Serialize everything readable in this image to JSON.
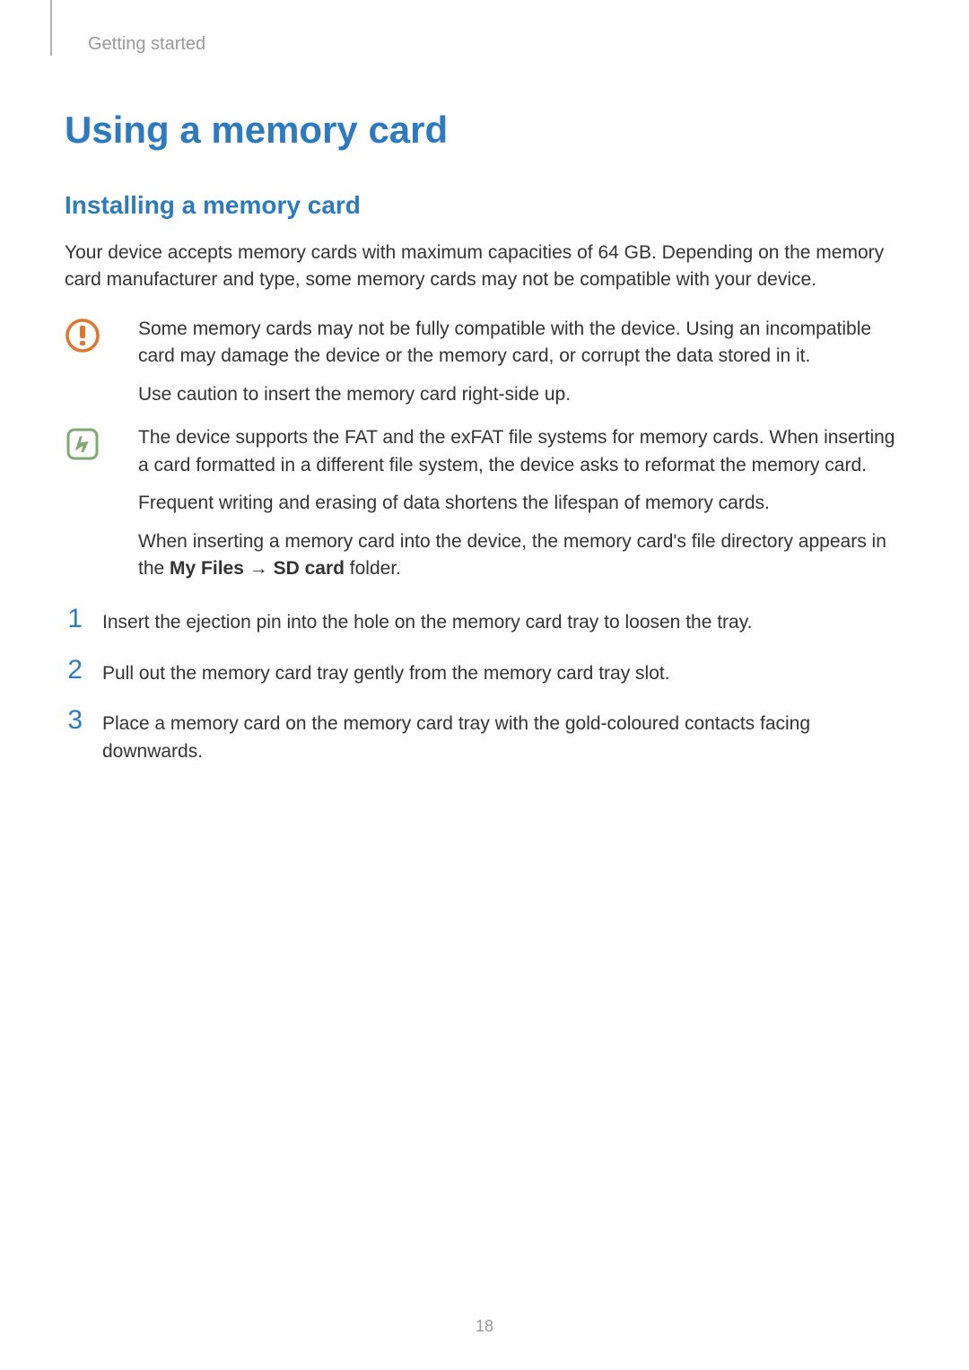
{
  "breadcrumb": "Getting started",
  "heading": "Using a memory card",
  "subheading": "Installing a memory card",
  "intro_text": "Your device accepts memory cards with maximum capacities of 64 GB. Depending on the memory card manufacturer and type, some memory cards may not be compatible with your device.",
  "warning": {
    "items": [
      "Some memory cards may not be fully compatible with the device. Using an incompatible card may damage the device or the memory card, or corrupt the data stored in it.",
      "Use caution to insert the memory card right-side up."
    ]
  },
  "note": {
    "item1": "The device supports the FAT and the exFAT file systems for memory cards. When inserting a card formatted in a different file system, the device asks to reformat the memory card.",
    "item2": "Frequent writing and erasing of data shortens the lifespan of memory cards.",
    "item3_pre": "When inserting a memory card into the device, the memory card's file directory appears in the ",
    "item3_bold1": "My Files",
    "item3_arrow": " → ",
    "item3_bold2": "SD card",
    "item3_post": " folder."
  },
  "steps": [
    {
      "num": "1",
      "text": "Insert the ejection pin into the hole on the memory card tray to loosen the tray."
    },
    {
      "num": "2",
      "text": "Pull out the memory card tray gently from the memory card tray slot."
    },
    {
      "num": "3",
      "text": "Place a memory card on the memory card tray with the gold-coloured contacts facing downwards."
    }
  ],
  "page_number": "18"
}
